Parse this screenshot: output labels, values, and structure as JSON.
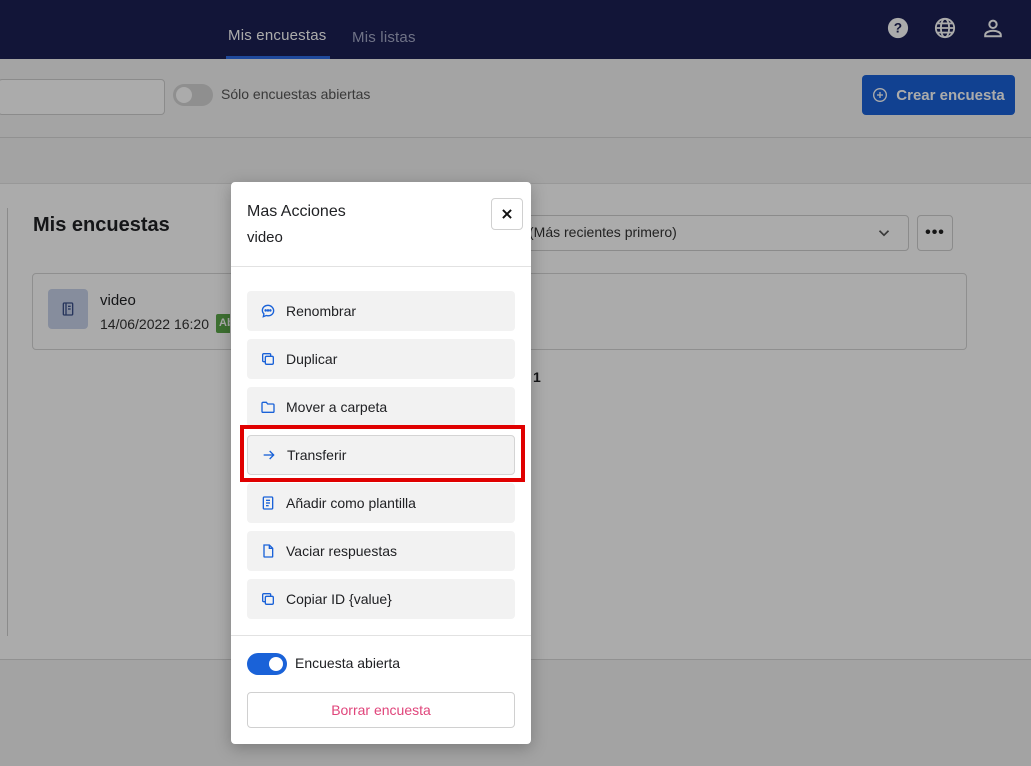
{
  "nav": {
    "tabs": [
      {
        "label": "Mis encuestas",
        "active": true
      },
      {
        "label": "Mis listas",
        "active": false
      }
    ],
    "icons": [
      "help-icon",
      "globe-icon",
      "user-icon"
    ]
  },
  "filters": {
    "toggle_label": "Sólo encuestas abiertas",
    "toggle_on": false,
    "create_button_label": "Crear encuesta"
  },
  "main": {
    "title": "Mis encuestas",
    "sort_value": "(Más recientes primero)",
    "more_button_label": "•••",
    "page_count": "1",
    "surveys": [
      {
        "title": "video",
        "date": "14/06/2022 16:20",
        "badge": "Ab"
      }
    ]
  },
  "modal": {
    "title": "Mas Acciones",
    "subtitle": "video",
    "actions": [
      {
        "label": "Renombrar",
        "icon": "chat-icon"
      },
      {
        "label": "Duplicar",
        "icon": "copy-icon"
      },
      {
        "label": "Mover a carpeta",
        "icon": "folder-icon"
      },
      {
        "label": "Transferir",
        "icon": "arrow-right-icon",
        "highlighted": true
      },
      {
        "label": "Añadir como plantilla",
        "icon": "template-icon"
      },
      {
        "label": "Vaciar respuestas",
        "icon": "file-icon"
      },
      {
        "label": "Copiar ID {value}",
        "icon": "copy-icon"
      }
    ],
    "open_toggle_label": "Encuesta abierta",
    "open_toggle_on": true,
    "delete_label": "Borrar encuesta"
  },
  "colors": {
    "nav_bg": "#1b2054",
    "primary": "#1a62d8",
    "delete_text": "#e0457b",
    "highlight_frame": "#e00000",
    "badge_green": "#5ba84a"
  }
}
